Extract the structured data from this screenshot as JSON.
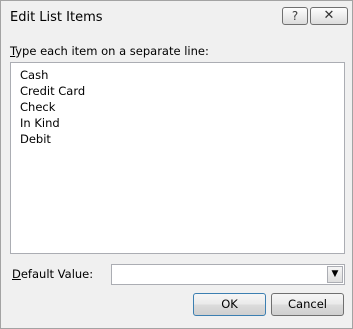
{
  "dialog": {
    "title": "Edit List Items",
    "help_glyph": "?",
    "close_glyph": "✕"
  },
  "prompt": {
    "accel": "T",
    "rest": "ype each item on a separate line:"
  },
  "items": [
    "Cash",
    "Credit Card",
    "Check",
    "In Kind",
    "Debit"
  ],
  "default_value": {
    "label_accel": "D",
    "label_rest": "efault Value:",
    "value": "",
    "arrow_glyph": "▼"
  },
  "buttons": {
    "ok": "OK",
    "cancel": "Cancel"
  },
  "colors": {
    "dialog_bg": "#f0f0f0",
    "field_border": "#abadb3"
  },
  "icons": {
    "help": "help-icon",
    "close": "close-icon",
    "dropdown": "chevron-down-icon"
  }
}
